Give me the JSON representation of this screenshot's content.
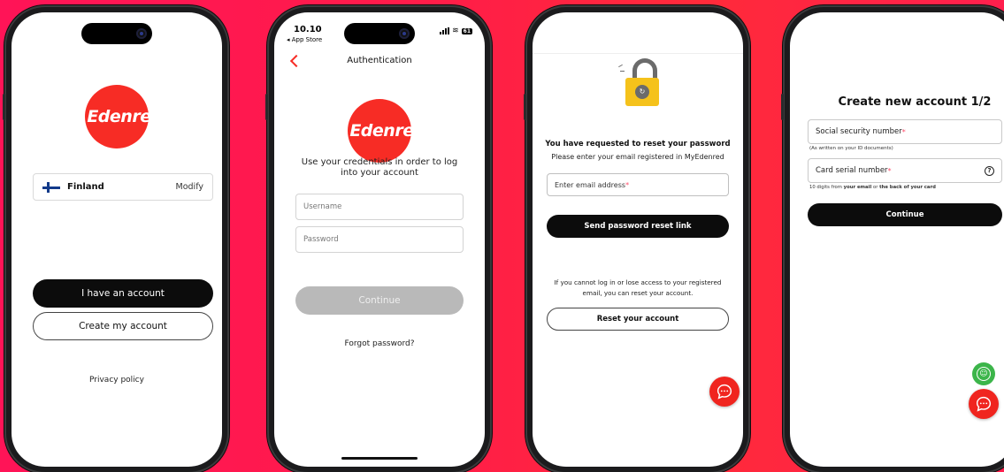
{
  "brand": {
    "logo_text": "Edenred",
    "accent": "#f72c25",
    "dark": "#0c0c0c"
  },
  "screen1": {
    "country": "Finland",
    "modify_label": "Modify",
    "have_account_label": "I have an account",
    "create_account_label": "Create my account",
    "privacy_label": "Privacy policy"
  },
  "screen2": {
    "time": "10.10",
    "back_app": "◂ App Store",
    "header_title": "Authentication",
    "subtitle": "Use your credentials in order to log into your account",
    "username_placeholder": "Username",
    "password_placeholder": "Password",
    "continue_label": "Continue",
    "forgot_label": "Forgot password?",
    "battery": "61"
  },
  "screen3": {
    "heading": "You have requested to reset your password",
    "subheading": "Please enter your email registered in MyEdenred",
    "email_placeholder": "Enter email address",
    "send_label": "Send password reset link",
    "help_text": "If you cannot log in or lose access to your registered email, you can reset your account.",
    "reset_label": "Reset your account"
  },
  "screen4": {
    "title": "Create new account 1/2",
    "ssn_label": "Social security number",
    "ssn_hint": "(As written on your ID documents)",
    "card_label": "Card serial number",
    "card_hint_pre": "10 digits from ",
    "card_hint_email": "your email",
    "card_hint_mid": " or ",
    "card_hint_back": "the back of your card",
    "continue_label": "Continue"
  },
  "required_mark": "*"
}
